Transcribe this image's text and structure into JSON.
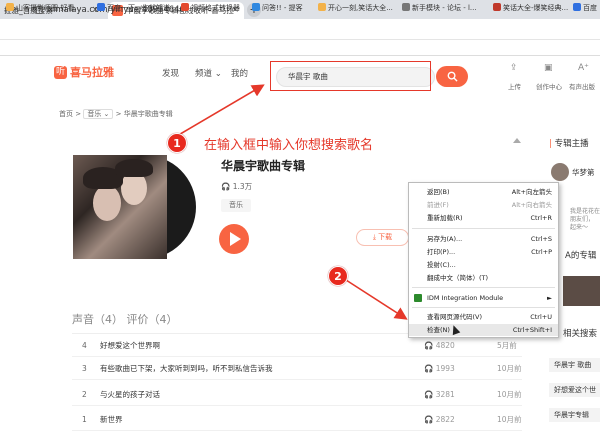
{
  "browser": {
    "tabs": [
      {
        "label": "拉雅_百度搜索"
      },
      {
        "label": "华晨宇歌曲专辑在线收听-喜马拉"
      }
    ],
    "new_tab": "+",
    "tab_close": "×",
    "url": "ximalaya.com/yinyue/40934640/",
    "nav": {
      "back": "←",
      "forward": "→",
      "reload": "C"
    },
    "bookmarks": [
      "山客摄影师圈-好看...",
      "百度一下，你就知道",
      "视频格式转换器",
      "问答!! - 提客",
      "开心一刻,笑话大全...",
      "新手模块 - 论坛 - l...",
      "笑话大全-爆笑经典...",
      "百度"
    ]
  },
  "site": {
    "logo_icon": "听",
    "logo_text": "喜马拉雅",
    "nav": [
      "发现",
      "频道 ⌄",
      "我的"
    ],
    "search_value": "华晨宇 歌曲",
    "search_icon": "magnifier",
    "header_actions": [
      {
        "icon": "upload-icon",
        "label": "上传"
      },
      {
        "icon": "creator-icon",
        "label": "创作中心"
      },
      {
        "icon": "audiobook-icon",
        "label": "有声出版"
      }
    ],
    "breadcrumb": [
      "首页 >",
      "音乐 ⌄",
      "> 华晨宇歌曲专辑"
    ]
  },
  "album": {
    "title": "华晨宇歌曲专辑",
    "plays": "1.3万",
    "tag": "音乐",
    "download_label": "下载",
    "tabs_label": "声音（4） 评价（4）",
    "tab_sound": "声音（4）",
    "tab_review": "评价（4）",
    "tracks": [
      {
        "num": "4",
        "title": "好想爱这个世界啊",
        "plays": "4820",
        "date": "5月前"
      },
      {
        "num": "3",
        "title": "有些歌曲已下架，大家听到到吗，听不到私信告诉我",
        "plays": "1993",
        "date": "10月前"
      },
      {
        "num": "2",
        "title": "与火星的孩子对话",
        "plays": "3281",
        "date": "10月前"
      },
      {
        "num": "1",
        "title": "新世界",
        "plays": "2822",
        "date": "10月前"
      }
    ]
  },
  "right": {
    "host_title": "专辑主播",
    "host_name": "华梦第",
    "host_desc1": "我是花花在",
    "host_desc2": "朋友们，",
    "host_desc3": "起来～",
    "album_label": "A的专辑",
    "related_label": "相关搜索",
    "related": [
      "华晨宇 歌曲",
      "好想爱这个世",
      "华晨宇专辑"
    ]
  },
  "annotations": {
    "step1": "1",
    "step1_text": "在输入框中输入你想搜索歌名",
    "step2": "2"
  },
  "context_menu": {
    "items": [
      {
        "label": "返回(B)",
        "key": "Alt+向左箭头"
      },
      {
        "label": "前进(F)",
        "key": "Alt+向右箭头",
        "disabled": true
      },
      {
        "label": "重新加载(R)",
        "key": "Ctrl+R"
      },
      {
        "label": "另存为(A)...",
        "key": "Ctrl+S"
      },
      {
        "label": "打印(P)...",
        "key": "Ctrl+P"
      },
      {
        "label": "投射(C)...",
        "key": ""
      },
      {
        "label": "翻成中文（简体）(T)",
        "key": ""
      },
      {
        "label": "IDM Integration Module",
        "key": "►"
      },
      {
        "label": "查看网页源代码(V)",
        "key": "Ctrl+U"
      },
      {
        "label": "检查(N)",
        "key": "Ctrl+Shift+I"
      }
    ]
  },
  "colors": {
    "brand": "#f86442",
    "annotation": "#e5382a"
  }
}
